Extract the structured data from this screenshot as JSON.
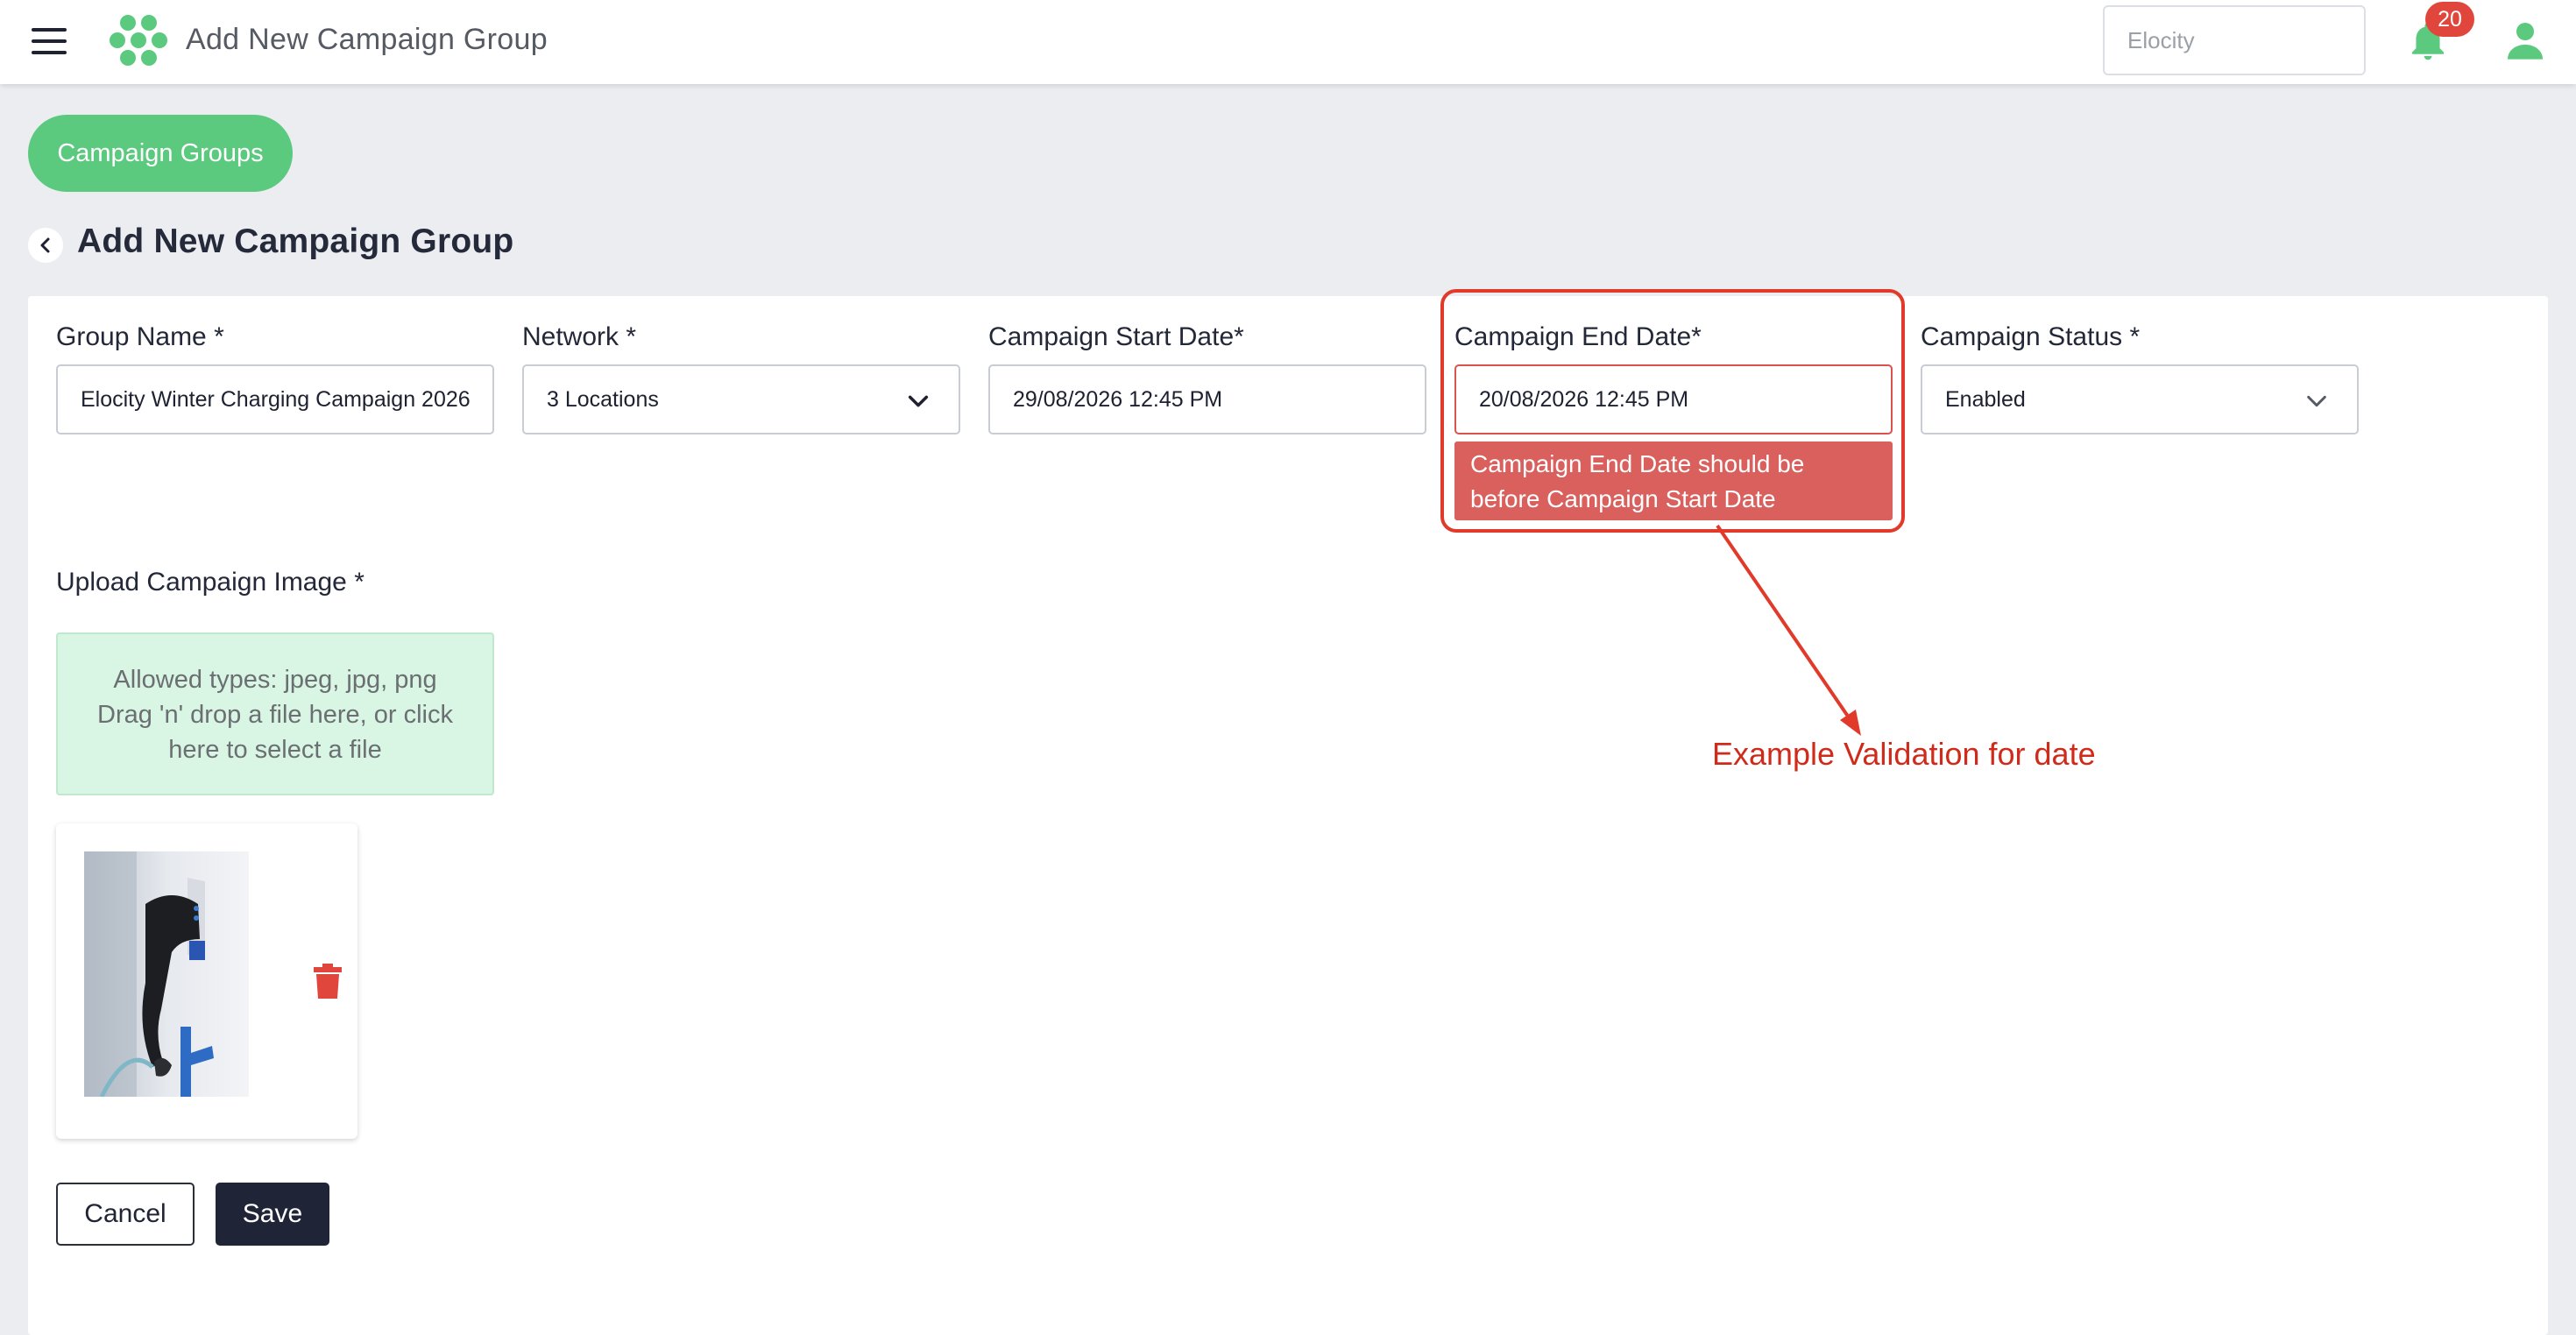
{
  "header": {
    "app_title": "Add New Campaign Group",
    "tenant_placeholder": "Elocity",
    "notification_count": "20"
  },
  "nav": {
    "campaign_groups_label": "Campaign Groups"
  },
  "page": {
    "title": "Add New Campaign Group"
  },
  "form": {
    "group_name": {
      "label": "Group Name *",
      "value": "Elocity Winter Charging Campaign 2026"
    },
    "network": {
      "label": "Network *",
      "value": "3 Locations"
    },
    "start_date": {
      "label": "Campaign Start Date*",
      "value": "29/08/2026 12:45 PM"
    },
    "end_date": {
      "label": "Campaign End Date*",
      "value": "20/08/2026 12:45 PM"
    },
    "status": {
      "label": "Campaign Status *",
      "value": "Enabled"
    },
    "end_date_error_line1": "Campaign End Date should be",
    "end_date_error_line2": "before Campaign Start Date",
    "upload": {
      "label": "Upload Campaign Image *",
      "line1": "Allowed types: jpeg, jpg, png",
      "line2": "Drag 'n' drop a file here, or click",
      "line3": "here to select a file"
    },
    "cancel_label": "Cancel",
    "save_label": "Save"
  },
  "annotation": {
    "text": "Example Validation for date"
  },
  "colors": {
    "brand_green": "#5bc97e",
    "error_red": "#d9605c",
    "annotation_red": "#cf2a1a",
    "primary_dark": "#1f2436"
  }
}
